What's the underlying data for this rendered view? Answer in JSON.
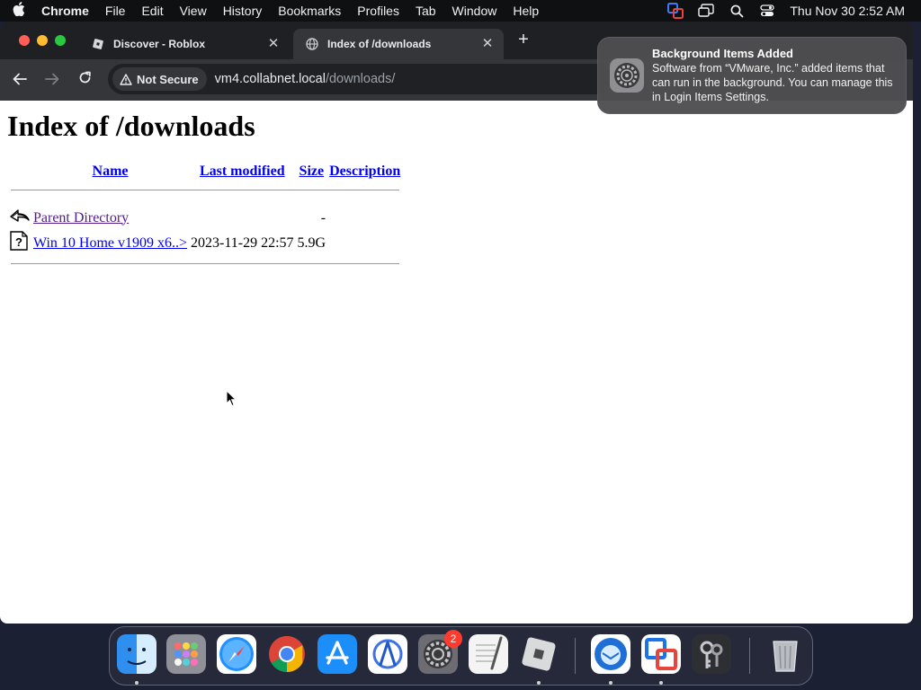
{
  "menubar": {
    "app_name": "Chrome",
    "menus": [
      "File",
      "Edit",
      "View",
      "History",
      "Bookmarks",
      "Profiles",
      "Tab",
      "Window",
      "Help"
    ],
    "clock": "Thu Nov 30  2:52 AM"
  },
  "browser": {
    "tabs": [
      {
        "title": "Discover - Roblox",
        "close": "✕"
      },
      {
        "title": "Index of /downloads",
        "close": "✕"
      }
    ],
    "new_tab": "+",
    "security_chip": "Not Secure",
    "url_host": "vm4.collabnet.local",
    "url_path": "/downloads/"
  },
  "page": {
    "heading": "Index of /downloads",
    "columns": [
      "Name",
      "Last modified",
      "Size",
      "Description"
    ],
    "rows": [
      {
        "name": "Parent Directory",
        "modified": "",
        "size": "-",
        "description": ""
      },
      {
        "name": "Win 10 Home v1909 x6..>",
        "modified": "2023-11-29 22:57",
        "size": "5.9G",
        "description": ""
      }
    ]
  },
  "notification": {
    "title": "Background Items Added",
    "body": "Software from “VMware, Inc.” added items that can run in the background. You can manage this in Login Items Settings."
  },
  "dock": {
    "items": [
      "finder",
      "launchpad",
      "safari",
      "chrome",
      "app-store",
      "instruments",
      "system-settings",
      "textedit",
      "roblox",
      "thunderbird",
      "vmware-fusion",
      "keychain-access",
      "trash"
    ],
    "system_settings_badge": "2"
  },
  "colors": {
    "link": "#0000ee",
    "visited_link": "#551a8b",
    "toolbar": "#35363a",
    "tabstrip": "#1f2023"
  }
}
